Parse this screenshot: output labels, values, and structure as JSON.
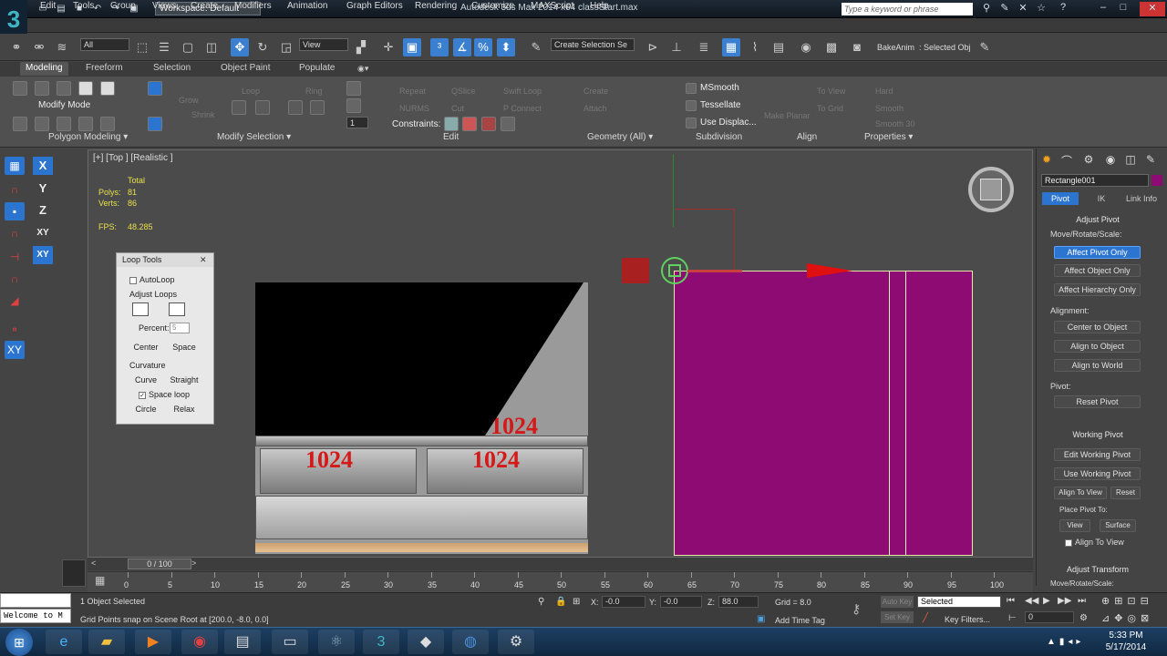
{
  "title_bar": {
    "workspace": "Workspace: Default",
    "app_title": "Autodesk 3ds Max 2014 x64    classStart.max",
    "search_placeholder": "Type a keyword or phrase"
  },
  "menu": [
    "Edit",
    "Tools",
    "Group",
    "Views",
    "Create",
    "Modifiers",
    "Animation",
    "Graph Editors",
    "Rendering",
    "Customize",
    "MAXScript",
    "Help"
  ],
  "toolbar": {
    "selection_filter": "All",
    "ref_coord": "View",
    "named_selection_placeholder": "Create Selection Se",
    "bake_label": "BakeAnim",
    "selected_obj_label": ": Selected Obj"
  },
  "ribbon": {
    "tabs": [
      "Modeling",
      "Freeform",
      "Selection",
      "Object Paint",
      "Populate"
    ],
    "active_tab": "Modeling",
    "modify_mode": "Modify Mode",
    "msmooth": "MSmooth",
    "tessellate": "Tessellate",
    "use_displace": "Use Displac...",
    "constraints": "Constraints:",
    "spinner_value": "1",
    "footer": [
      "Polygon Modeling",
      "Modify Selection",
      "Edit",
      "Geometry (All)",
      "Subdivision",
      "Align",
      "Properties"
    ],
    "dim_items": [
      "Loop",
      "Ring",
      "Grow",
      "Shrink",
      "Repeat",
      "NURMS",
      "Cut",
      "QSlice",
      "Swift Loop",
      "P Connect",
      "Create",
      "Attach",
      "Make Planar",
      "To View",
      "To Grid",
      "Hard",
      "Smooth",
      "Smooth 30"
    ]
  },
  "axis_buttons": [
    "X",
    "Y",
    "Z",
    "XY",
    "XY"
  ],
  "viewport": {
    "label": "[+] [Top ] [Realistic ]",
    "stats_header": "Total",
    "polys_label": "Polys:",
    "polys_value": "81",
    "verts_label": "Verts:",
    "verts_value": "86",
    "fps_label": "FPS:",
    "fps_value": "48.285",
    "texture_number": "1024"
  },
  "loop_tools": {
    "title": "Loop Tools",
    "autoloop": "AutoLoop",
    "adjust_loops": "Adjust Loops",
    "percent_label": "Percent:",
    "percent_value": "5",
    "center": "Center",
    "space": "Space",
    "curvature": "Curvature",
    "curve": "Curve",
    "straight": "Straight",
    "space_loop": "Space loop",
    "circle": "Circle",
    "relax": "Relax"
  },
  "command_panel": {
    "object_name": "Rectangle001",
    "object_color": "#8d0b72",
    "tabs": [
      "Pivot",
      "IK",
      "Link Info"
    ],
    "active_tab": "Pivot",
    "adjust_pivot": "Adjust Pivot",
    "move_rotate_scale": "Move/Rotate/Scale:",
    "affect_pivot_only": "Affect Pivot Only",
    "affect_object_only": "Affect Object Only",
    "affect_hierarchy_only": "Affect Hierarchy Only",
    "alignment": "Alignment:",
    "center_to_object": "Center to Object",
    "align_to_object": "Align to Object",
    "align_to_world": "Align to World",
    "pivot_label": "Pivot:",
    "reset_pivot": "Reset Pivot",
    "working_pivot": "Working Pivot",
    "edit_working_pivot": "Edit Working Pivot",
    "use_working_pivot": "Use Working Pivot",
    "align_to_view_btn": "Align To View",
    "reset": "Reset",
    "place_pivot_to": "Place Pivot To:",
    "view": "View",
    "surface": "Surface",
    "align_to_view_check": "Align To View",
    "adjust_transform": "Adjust Transform",
    "move_rotate_scale2": "Move/Rotate/Scale:"
  },
  "timeline": {
    "frame_display": "0 / 100",
    "ticks": [
      "0",
      "5",
      "10",
      "15",
      "20",
      "25",
      "30",
      "35",
      "40",
      "45",
      "50",
      "55",
      "60",
      "65",
      "70",
      "75",
      "80",
      "85",
      "90",
      "95",
      "100"
    ]
  },
  "status": {
    "welcome": "Welcome to M",
    "selection_status": "1 Object Selected",
    "prompt": "Grid Points snap on Scene Root at [200.0, -8.0, 0.0]",
    "x_label": "X:",
    "x_value": "-0.0",
    "y_label": "Y:",
    "y_value": "-0.0",
    "z_label": "Z:",
    "z_value": "88.0",
    "grid": "Grid = 8.0",
    "add_time_tag": "Add Time Tag",
    "auto_key": "Auto Key",
    "set_key": "Set Key",
    "key_mode": "Selected",
    "key_filters": "Key Filters...",
    "frame": "0"
  },
  "taskbar": {
    "time": "5:33 PM",
    "date": "5/17/2014"
  }
}
